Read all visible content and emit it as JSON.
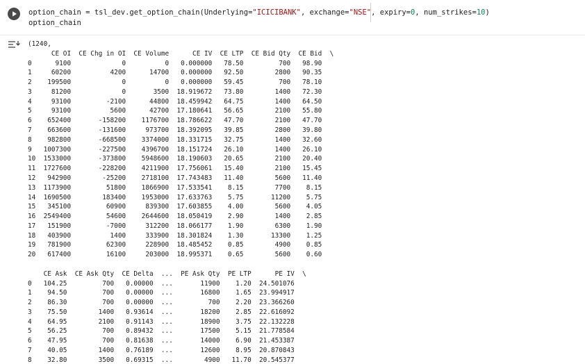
{
  "cell": {
    "run_button_icon": "play-icon",
    "output_menu_icon": "output-actions-icon",
    "code": {
      "line1": {
        "pre": "option_chain = tsl_dev.get_option_chain(Underlying=",
        "str1": "\"ICICIBANK\"",
        "mid1": ", exchange=",
        "str2": "\"NSE\"",
        "mid2": ", expiry=",
        "num1": "0",
        "mid3": ", num_strikes=",
        "num2": "10",
        "post": ")"
      },
      "line2": "option_chain"
    },
    "output": {
      "lines": [
        "(1240,",
        "      CE OI  CE Chg in OI  CE Volume      CE IV  CE LTP  CE Bid Qty  CE Bid  \\",
        "0      9100             0          0   0.000000   78.50         700   98.90",
        "1     60200          4200      14700   0.000000   92.50        2800   90.35",
        "2    199500             0          0   0.000000   59.45         700   78.10",
        "3     81200             0       3500  18.919672   73.80        1400   72.30",
        "4     93100         -2100      44800  18.459942   64.75        1400   64.50",
        "5     93100          5600      42700  17.180641   56.65        2100   55.80",
        "6    652400       -158200    1176700  18.786622   47.70        2100   47.70",
        "7    663600       -131600     973700  18.392095   39.85        2800   39.80",
        "8    982800       -668500    3374000  18.331715   32.75        1400   32.60",
        "9   1007300       -227500    4396700  18.151724   26.10        1400   26.10",
        "10  1533000       -373800    5948600  18.190603   20.65        2100   20.40",
        "11  1727600       -228200    4211900  17.756061   15.40        2100   15.45",
        "12   942900        -25200    2718100  17.743483   11.40        5600   11.40",
        "13  1173900         51800    1866900  17.533541    8.15        7700    8.15",
        "14  1690500        183400    1953000  17.633763    5.75       11200    5.75",
        "15   345100         60900     839300  17.603855    4.00        5600    4.05",
        "16  2549400         54600    2644600  18.050419    2.90        1400    2.85",
        "17   151900         -7000     312200  18.066177    1.90        6300    1.90",
        "18   403900          1400     333900  18.301824    1.30       13300    1.25",
        "19   781900         62300     228900  18.485452    0.85        4900    0.85",
        "20   617400         16100     203000  18.995371    0.65        5600    0.60",
        "",
        "    CE Ask  CE Ask Qty  CE Delta  ...  PE Ask Qty  PE LTP      PE IV  \\",
        "0   104.25         700   0.00000  ...       11900    1.20  24.501076",
        "1    94.50         700   0.00000  ...       16800    1.65  23.994917",
        "2    86.30         700   0.00000  ...         700    2.20  23.366260",
        "3    75.50        1400   0.93614  ...       18200    2.85  22.616092",
        "4    64.95        2100   0.91143  ...       18900    3.75  22.132228",
        "5    56.25         700   0.89432  ...       17500    5.15  21.778584",
        "6    47.95         700   0.81638  ...       14000    6.90  21.453387",
        "7    40.05        1400   0.76189  ...       12600    8.95  20.870843",
        "8    32.80        3500   0.69315  ...        4900   11.70  20.545377"
      ]
    }
  }
}
